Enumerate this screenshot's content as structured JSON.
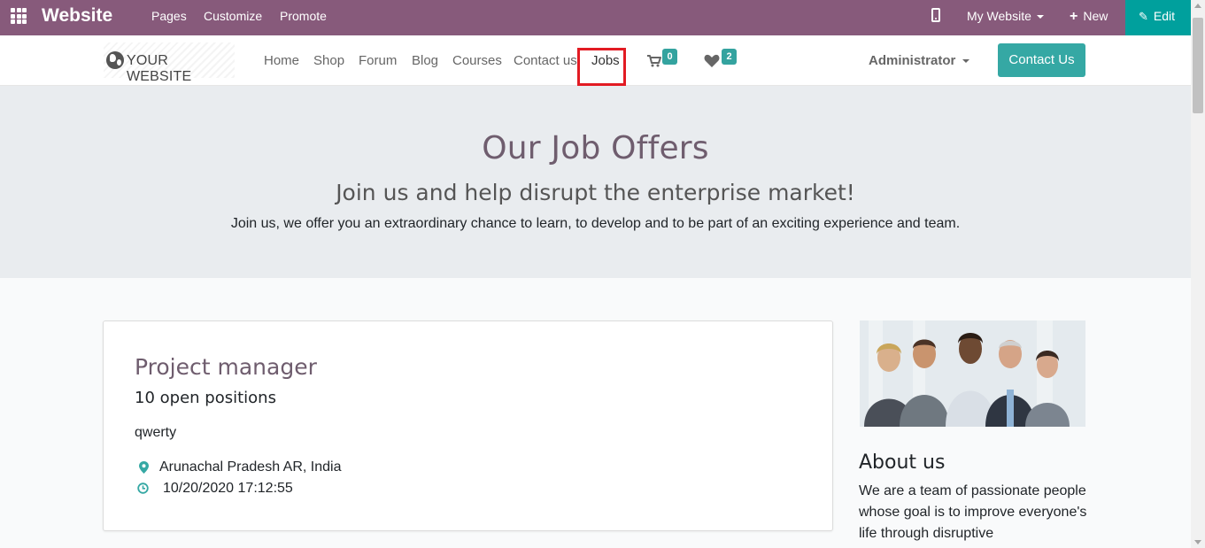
{
  "editor_bar": {
    "brand": "Website",
    "menu": [
      "Pages",
      "Customize",
      "Promote"
    ],
    "website_switch": "My Website",
    "new_label": "New",
    "edit_label": "Edit",
    "color": "#875a7b",
    "edit_color": "#00a09d"
  },
  "navbar": {
    "logo_text": "YOUR WEBSITE",
    "links": [
      "Home",
      "Shop",
      "Forum",
      "Blog",
      "Courses",
      "Contact us",
      "Jobs"
    ],
    "active_link": "Jobs",
    "cart_count": "0",
    "wishlist_count": "2",
    "user": "Administrator",
    "cta_label": "Contact Us",
    "accent": "#35a8a4",
    "highlight_color": "#e21b23"
  },
  "hero": {
    "title": "Our Job Offers",
    "subtitle": "Join us and help disrupt the enterprise market!",
    "lead": "Join us, we offer you an extraordinary chance to learn, to develop and to be part of an exciting experience and team."
  },
  "job": {
    "title": "Project manager",
    "openings": "10 open positions",
    "description": "qwerty",
    "location": "Arunachal Pradesh AR, India",
    "datetime": "10/20/2020 17:12:55"
  },
  "sidebar": {
    "about_title": "About us",
    "about_text": "We are a team of passionate people whose goal is to improve everyone's life through disruptive"
  }
}
